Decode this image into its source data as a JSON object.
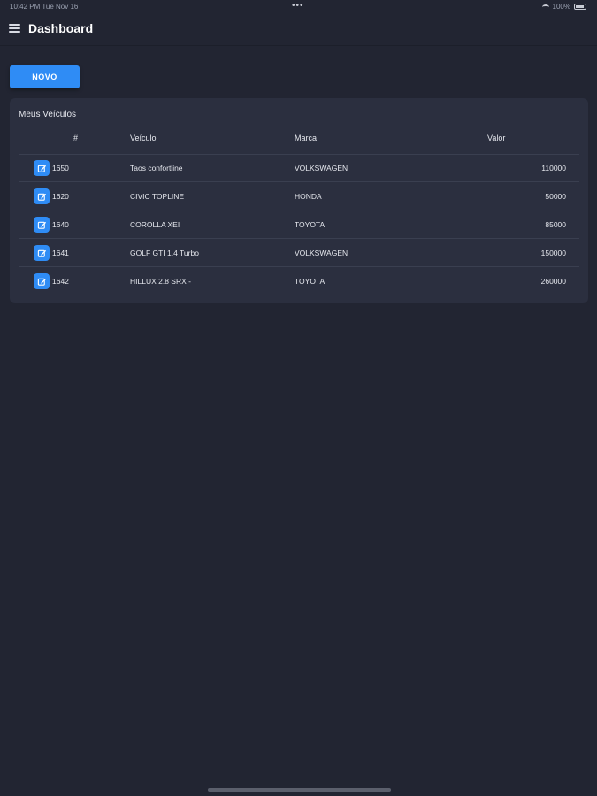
{
  "status_bar": {
    "time": "10:42 PM  Tue Nov 16",
    "battery": "100%",
    "dots": "•••"
  },
  "header": {
    "title": "Dashboard",
    "menu_icon": "hamburger-menu-icon"
  },
  "toolbar": {
    "novo_label": "NOVO"
  },
  "table": {
    "title": "Meus Veículos",
    "columns": [
      "#",
      "Veículo",
      "Marca",
      "Valor"
    ],
    "edit_icon": "edit-icon",
    "rows": [
      {
        "id": "1650",
        "veiculo": "Taos confortline",
        "marca": "VOLKSWAGEN",
        "valor": "110000"
      },
      {
        "id": "1620",
        "veiculo": "CIVIC TOPLINE",
        "marca": "HONDA",
        "valor": "50000"
      },
      {
        "id": "1640",
        "veiculo": "COROLLA XEI",
        "marca": "TOYOTA",
        "valor": "85000"
      },
      {
        "id": "1641",
        "veiculo": "GOLF GTI 1.4 Turbo",
        "marca": "VOLKSWAGEN",
        "valor": "150000"
      },
      {
        "id": "1642",
        "veiculo": "HILLUX 2.8 SRX -",
        "marca": "TOYOTA",
        "valor": "260000"
      }
    ]
  },
  "colors": {
    "background": "#222532",
    "card": "#2b2f3f",
    "accent": "#2f8cf5"
  }
}
